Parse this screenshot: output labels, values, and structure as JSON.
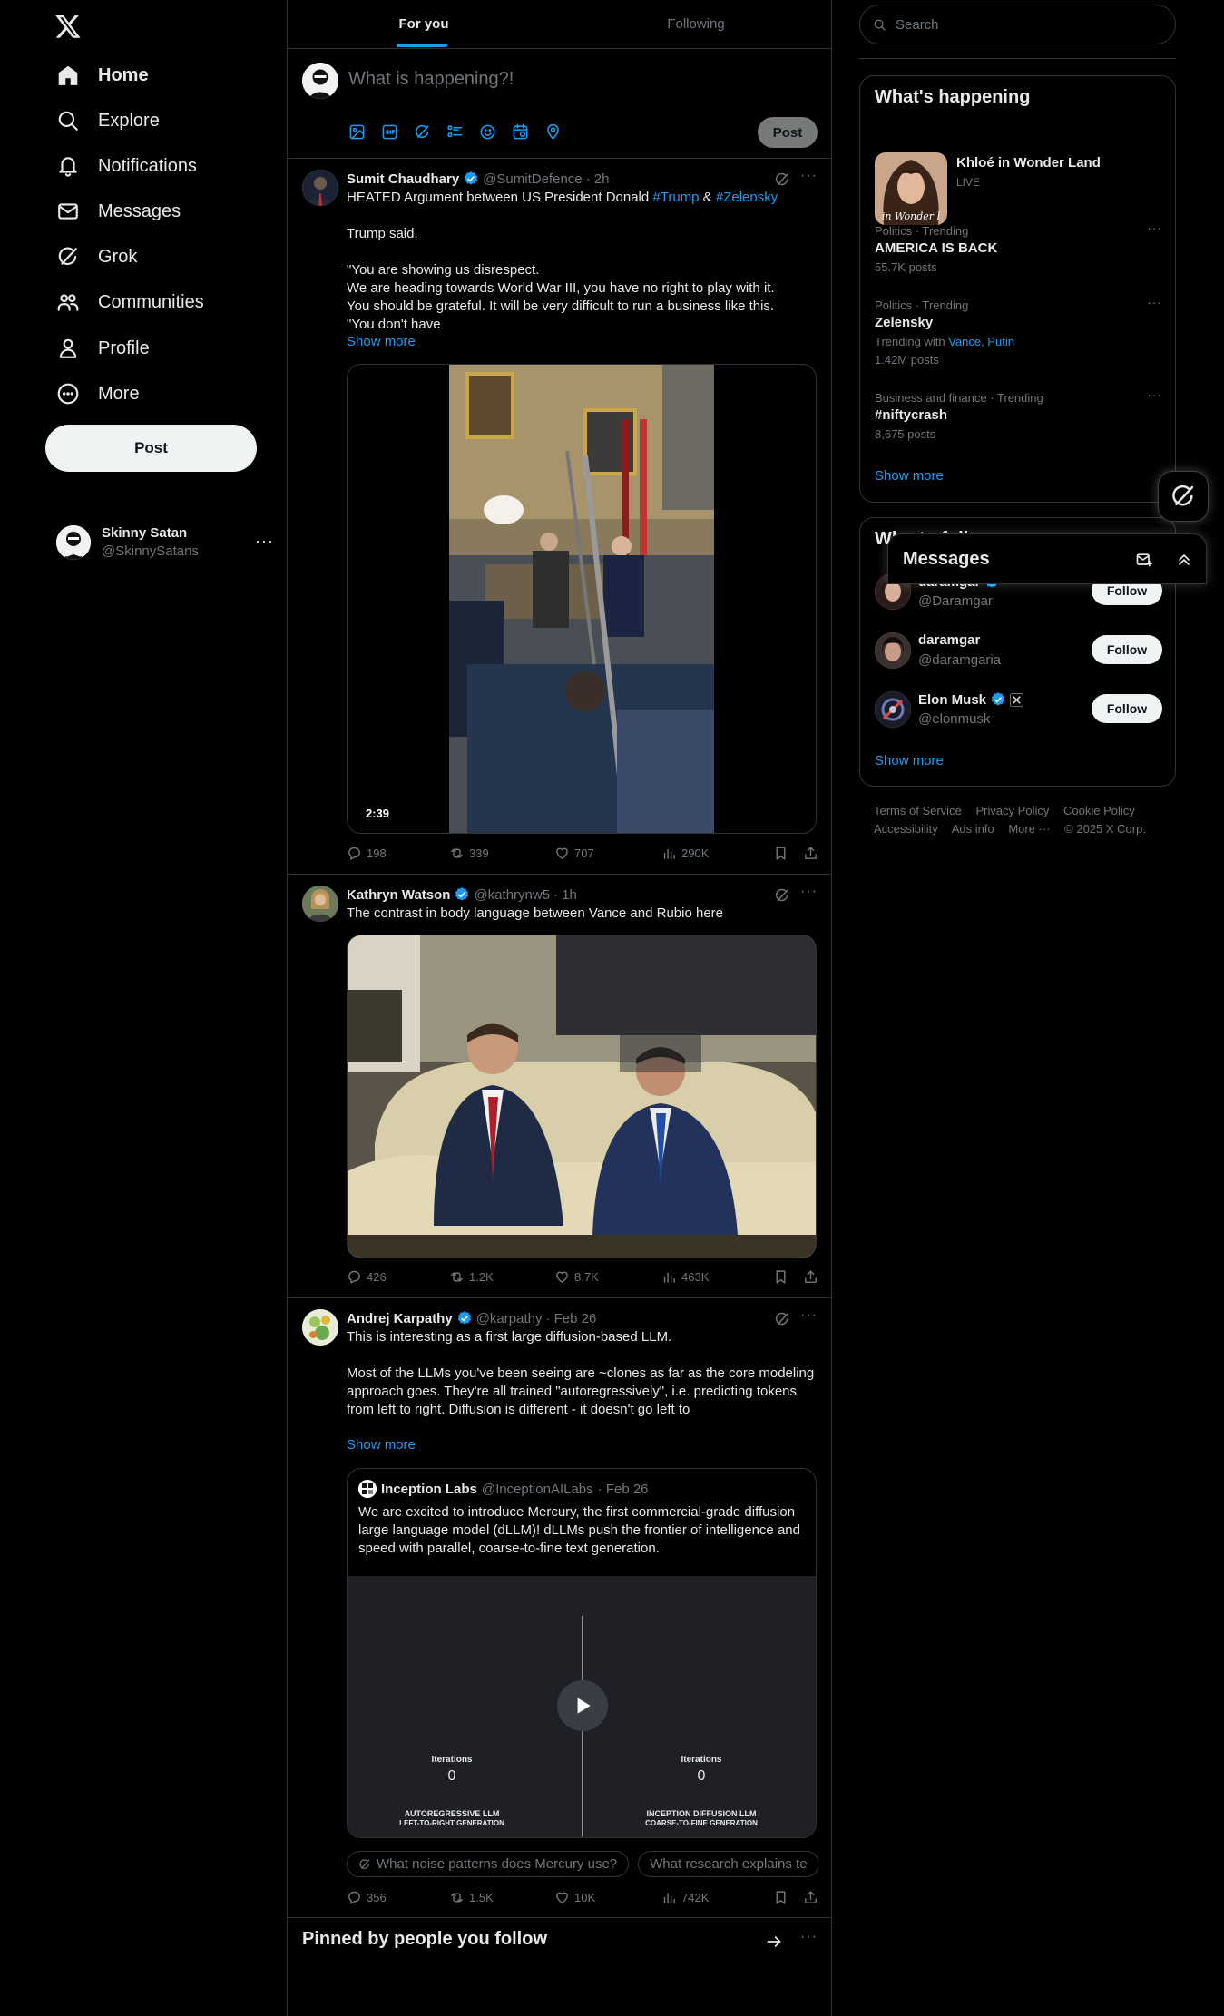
{
  "sidebar": {
    "nav": [
      "Home",
      "Explore",
      "Notifications",
      "Messages",
      "Grok",
      "Communities",
      "Profile",
      "More"
    ],
    "post_label": "Post",
    "account": {
      "name": "Skinny Satan",
      "handle": "@SkinnySatans"
    }
  },
  "tabs": [
    "For you",
    "Following"
  ],
  "composer": {
    "placeholder": "What is happening?!",
    "post_label": "Post"
  },
  "tweets": [
    {
      "name": "Sumit Chaudhary",
      "handle": "@SumitDefence",
      "time": "· 2h",
      "body_prefix": "HEATED Argument between US President Donald ",
      "hashtag1": "#Trump",
      "body_mid": " & ",
      "hashtag2": "#Zelensky",
      "body_rest": "Trump said.\n\n\"You are showing us disrespect.\nWe are heading towards World War III, you have no right to play with it.\nYou should be grateful. It will be very difficult to run a business like this.\n\"You don't have",
      "show_more": "Show more",
      "video_duration": "2:39",
      "stats": {
        "replies": "198",
        "reposts": "339",
        "likes": "707",
        "views": "290K"
      }
    },
    {
      "name": "Kathryn Watson",
      "handle": "@kathrynw5",
      "time": "· 1h",
      "body": "The contrast in body language between Vance and Rubio here",
      "stats": {
        "replies": "426",
        "reposts": "1.2K",
        "likes": "8.7K",
        "views": "463K"
      }
    },
    {
      "name": "Andrej Karpathy",
      "handle": "@karpathy",
      "time": "· Feb 26",
      "body": "This is interesting as a first large diffusion-based LLM.\n\nMost of the LLMs you've been seeing are ~clones as far as the core modeling approach goes. They're all trained \"autoregressively\", i.e. predicting tokens from left to right. Diffusion is different - it doesn't go left to",
      "show_more": "Show more",
      "quote": {
        "name": "Inception Labs",
        "handle": "@InceptionAILabs",
        "time": "· Feb 26",
        "body": "We are excited to introduce Mercury, the first commercial-grade diffusion large language model (dLLM)! dLLMs push the frontier of intelligence and speed with parallel, coarse-to-fine text generation.",
        "left_label": "Iterations",
        "left_value": "0",
        "left_caption1": "AUTOREGRESSIVE LLM",
        "left_caption2": "LEFT-TO-RIGHT GENERATION",
        "right_label": "Iterations",
        "right_value": "0",
        "right_caption1": "INCEPTION DIFFUSION LLM",
        "right_caption2": "COARSE-TO-FINE GENERATION"
      },
      "chips": [
        "What noise patterns does Mercury use?",
        "What research explains te"
      ],
      "stats": {
        "replies": "356",
        "reposts": "1.5K",
        "likes": "10K",
        "views": "742K"
      }
    }
  ],
  "pinned": {
    "title": "Pinned by people you follow"
  },
  "right": {
    "search_placeholder": "Search",
    "whats_happening": {
      "title": "What's happening",
      "event_title": "Khloé in Wonder Land",
      "event_status": "LIVE",
      "event_image_text": "in Wonder l",
      "trends": [
        {
          "category": "Politics · Trending",
          "name": "AMERICA IS BACK",
          "posts": "55.7K posts"
        },
        {
          "category": "Politics · Trending",
          "name": "Zelensky",
          "with_label": "Trending with",
          "with_links": "Vance, Putin",
          "posts": "1.42M posts"
        },
        {
          "category": "Business and finance · Trending",
          "name": "#niftycrash",
          "posts": "8,675 posts"
        }
      ],
      "show_more": "Show more"
    },
    "who_to_follow": {
      "title": "Who to follow",
      "accounts": [
        {
          "name": "daramgar",
          "handle": "@Daramgar",
          "button": "Follow"
        },
        {
          "name": "daramgar",
          "handle": "@daramgaria",
          "button": "Follow"
        },
        {
          "name": "Elon Musk",
          "handle": "@elonmusk",
          "button": "Follow"
        }
      ],
      "show_more": "Show more"
    },
    "footer": [
      "Terms of Service",
      "Privacy Policy",
      "Cookie Policy",
      "Accessibility",
      "Ads info",
      "More ···",
      "© 2025 X Corp."
    ]
  },
  "messages_drawer": {
    "title": "Messages"
  },
  "colors": {
    "accent": "#1d9bf0",
    "background": "#000000",
    "border": "#2f3336",
    "muted": "#71767b"
  }
}
